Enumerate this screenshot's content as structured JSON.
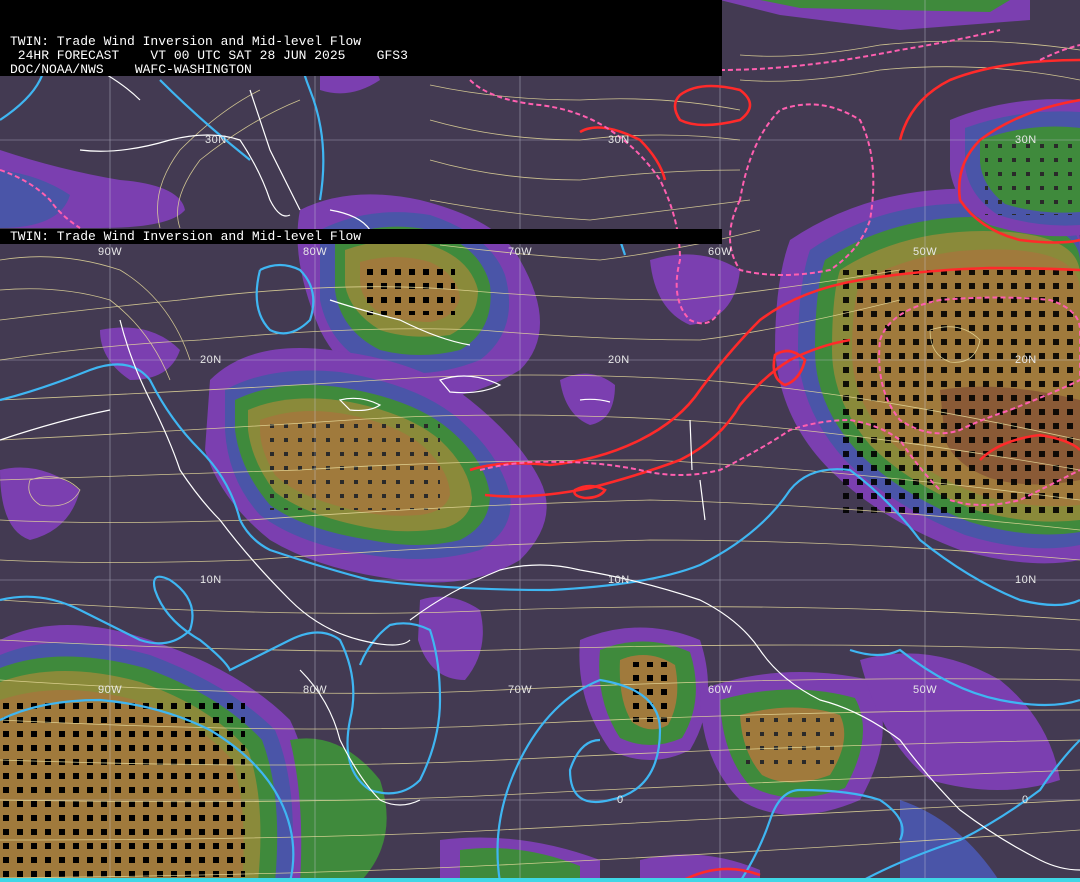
{
  "header": {
    "line1": "TWIN: Trade Wind Inversion and Mid-level Flow",
    "line2": " 24HR FORECAST    VT 00 UTC SAT 28 JUN 2025    GFS3",
    "line3": "DOC/NOAA/NWS    WAFC-WASHINGTON"
  },
  "subheader": {
    "title": "TWIN: Trade Wind Inversion and Mid-level Flow"
  },
  "labels": {
    "lat30_a": "30N",
    "lat30_b": "30N",
    "lat30_c": "30N",
    "lon90_top": "90W",
    "lon80_top": "80W",
    "lon70_top": "70W",
    "lon60_top": "60W",
    "lon50_top": "50W",
    "lat20_a": "20N",
    "lat20_b": "20N",
    "lat20_c": "20N",
    "lat10_a": "10N",
    "lat10_b": "10N",
    "lat10_c": "10N",
    "lon90_bot": "90W",
    "lon80_bot": "80W",
    "lon70_bot": "70W",
    "lon60_bot": "60W",
    "lon50_bot": "50W",
    "eq_a": "0",
    "eq_b": "0"
  },
  "colors": {
    "background": "#433a52",
    "purple": "#7b3fb0",
    "blue": "#4a55a8",
    "green": "#3f8a3c",
    "olive": "#8a8a3a",
    "tan": "#a07a3c",
    "brown": "#8a5a36",
    "cyan_contour": "#3fb6f2",
    "red_contour": "#ff2a2a",
    "pink_dashed": "#ff5fb0",
    "streamline": "#e8dc9c",
    "coast": "#ffffff",
    "grid": "#c8c8d8"
  }
}
